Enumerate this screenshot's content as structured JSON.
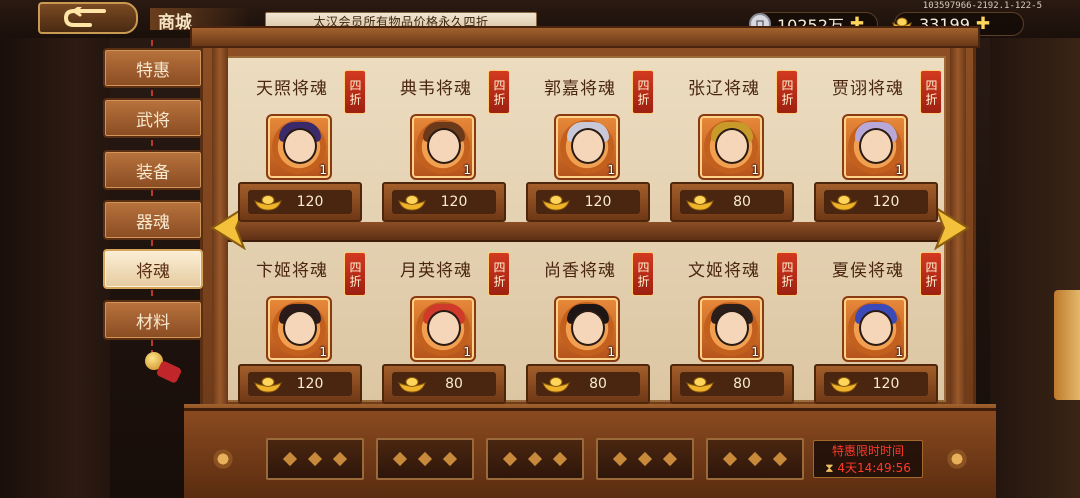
{
  "header": {
    "title": "商城",
    "notice": "太汉会员所有物品价格永久四折",
    "server_id": "103597966-2192.1-122-5",
    "silver": "10252万",
    "gold": "33199"
  },
  "tabs": [
    {
      "label": "特惠",
      "active": false
    },
    {
      "label": "武将",
      "active": false
    },
    {
      "label": "装备",
      "active": false
    },
    {
      "label": "器魂",
      "active": false
    },
    {
      "label": "将魂",
      "active": true
    },
    {
      "label": "材料",
      "active": false
    }
  ],
  "discount_tag": "四折",
  "items": [
    {
      "name": "天照将魂",
      "count": "1",
      "price": "120",
      "hair": "#3a2a6a"
    },
    {
      "name": "典韦将魂",
      "count": "1",
      "price": "120",
      "hair": "#6a3a1a"
    },
    {
      "name": "郭嘉将魂",
      "count": "1",
      "price": "120",
      "hair": "#c8c8d8"
    },
    {
      "name": "张辽将魂",
      "count": "1",
      "price": "80",
      "hair": "#c89a2a"
    },
    {
      "name": "贾诩将魂",
      "count": "1",
      "price": "120",
      "hair": "#b8a8d8"
    },
    {
      "name": "卞姬将魂",
      "count": "1",
      "price": "120",
      "hair": "#2a1a1a"
    },
    {
      "name": "月英将魂",
      "count": "1",
      "price": "80",
      "hair": "#d03a2a"
    },
    {
      "name": "尚香将魂",
      "count": "1",
      "price": "80",
      "hair": "#1e1614"
    },
    {
      "name": "文姬将魂",
      "count": "1",
      "price": "80",
      "hair": "#2a1e1a"
    },
    {
      "name": "夏侯将魂",
      "count": "1",
      "price": "120",
      "hair": "#3a4ab8"
    }
  ],
  "timer": {
    "label": "特惠限时时间",
    "value": "4天14:49:56"
  }
}
